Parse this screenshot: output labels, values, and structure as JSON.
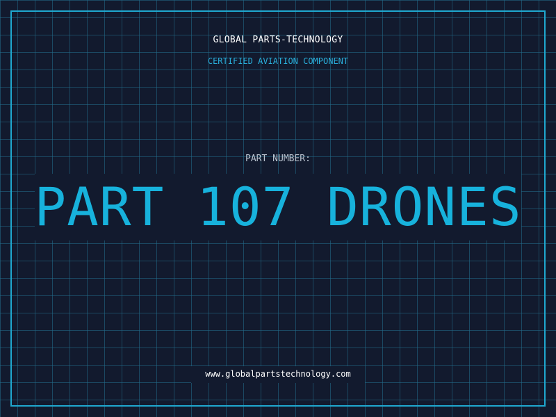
{
  "header": {
    "brand": "GLOBAL PARTS-TECHNOLOGY",
    "subtitle": "CERTIFIED AVIATION COMPONENT"
  },
  "part": {
    "label": "PART NUMBER:",
    "value": "PART 107 DRONES"
  },
  "footer": {
    "url": "www.globalpartstechnology.com"
  },
  "colors": {
    "background": "#121a2e",
    "grid": "#236e8c",
    "accent": "#17b2dc",
    "frame": "#1fa8cf",
    "text": "#ffffff",
    "muted": "#b9c3cf"
  }
}
